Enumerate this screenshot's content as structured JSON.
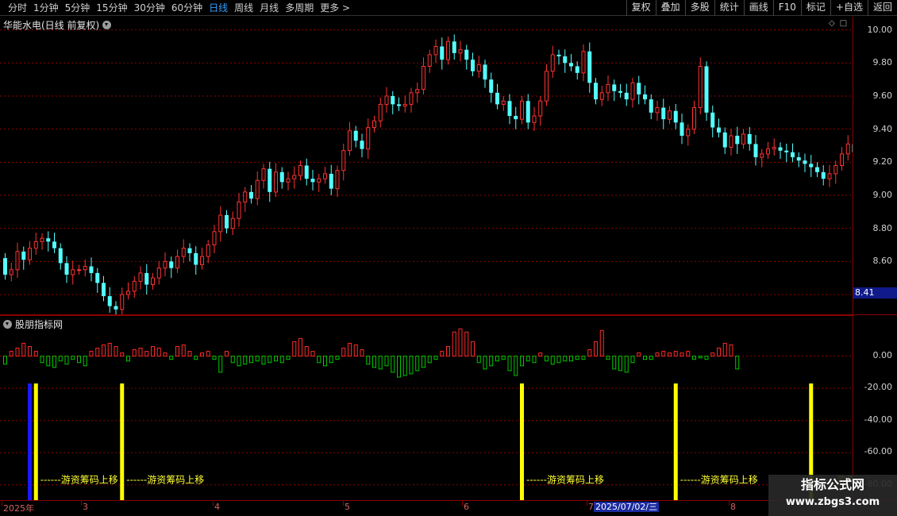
{
  "toolbar": {
    "periods": [
      "分时",
      "1分钟",
      "5分钟",
      "15分钟",
      "30分钟",
      "60分钟",
      "日线",
      "周线",
      "月线",
      "多周期",
      "更多 >"
    ],
    "active_period": "日线",
    "tools": [
      "复权",
      "叠加",
      "多股",
      "统计",
      "画线",
      "F10",
      "标记",
      "+自选",
      "返回"
    ]
  },
  "main_panel": {
    "title": "华能水电(日线 前复权)",
    "current_price_label": "8.41",
    "corner_icons": [
      "diamond-icon",
      "square-icon"
    ]
  },
  "sub_panel": {
    "title": "股朋指标网",
    "signal_label": "游资筹码上移",
    "signal_prefix": "------"
  },
  "x_axis": {
    "labels": [
      "2025年",
      "3",
      "4",
      "5",
      "6",
      "7",
      "8"
    ],
    "cursor_date": "2025/07/02/三"
  },
  "watermark": {
    "title": "指标公式网",
    "url": "www.zbgs3.com"
  },
  "colors": {
    "up": "#ff3232",
    "down": "#54ffff",
    "grid": "#8b0000",
    "osc_up": "#ff2a2a",
    "osc_down": "#00c800",
    "signal_yellow": "#ffff00",
    "signal_blue": "#1a1aff",
    "label_yellow": "#ffff33"
  },
  "chart_data": [
    {
      "type": "candlestick",
      "title": "华能水电(日线 前复权)",
      "y_axis_ticks": [
        "10.00",
        "9.80",
        "9.60",
        "9.40",
        "9.20",
        "9.00",
        "8.80",
        "8.60",
        "8.40"
      ],
      "ylim": [
        8.28,
        10.08
      ],
      "current_price": 8.41,
      "close": [
        8.52,
        8.55,
        8.66,
        8.61,
        8.68,
        8.72,
        8.74,
        8.72,
        8.68,
        8.59,
        8.52,
        8.55,
        8.55,
        8.57,
        8.53,
        8.47,
        8.39,
        8.33,
        8.31,
        8.4,
        8.42,
        8.48,
        8.53,
        8.46,
        8.5,
        8.56,
        8.6,
        8.56,
        8.63,
        8.68,
        8.65,
        8.58,
        8.63,
        8.7,
        8.78,
        8.88,
        8.8,
        8.86,
        8.96,
        9.02,
        8.98,
        9.09,
        9.16,
        9.02,
        9.14,
        9.08,
        9.1,
        9.12,
        9.18,
        9.1,
        9.08,
        9.1,
        9.13,
        9.04,
        9.15,
        9.27,
        9.39,
        9.33,
        9.28,
        9.41,
        9.45,
        9.55,
        9.6,
        9.55,
        9.54,
        9.55,
        9.62,
        9.64,
        9.78,
        9.85,
        9.9,
        9.82,
        9.93,
        9.86,
        9.88,
        9.82,
        9.75,
        9.79,
        9.7,
        9.62,
        9.55,
        9.57,
        9.48,
        9.46,
        9.57,
        9.44,
        9.48,
        9.57,
        9.75,
        9.85,
        9.84,
        9.8,
        9.78,
        9.74,
        9.87,
        9.68,
        9.58,
        9.62,
        9.67,
        9.63,
        9.62,
        9.58,
        9.68,
        9.61,
        9.58,
        9.5,
        9.53,
        9.46,
        9.51,
        9.44,
        9.36,
        9.4,
        9.53,
        9.78,
        9.5,
        9.41,
        9.38,
        9.29,
        9.36,
        9.31,
        9.37,
        9.31,
        9.23,
        9.25,
        9.28,
        9.29,
        9.27,
        9.26,
        9.23,
        9.21,
        9.19,
        9.17,
        9.14,
        9.1,
        9.13,
        9.18,
        9.25,
        9.31,
        9.26
      ],
      "open": [
        8.62,
        8.52,
        8.55,
        8.66,
        8.61,
        8.68,
        8.72,
        8.74,
        8.72,
        8.68,
        8.59,
        8.52,
        8.55,
        8.55,
        8.57,
        8.53,
        8.47,
        8.39,
        8.33,
        8.31,
        8.4,
        8.42,
        8.48,
        8.53,
        8.46,
        8.5,
        8.56,
        8.6,
        8.56,
        8.63,
        8.68,
        8.65,
        8.58,
        8.63,
        8.7,
        8.78,
        8.88,
        8.8,
        8.86,
        8.96,
        9.02,
        8.98,
        9.09,
        9.16,
        9.02,
        9.14,
        9.08,
        9.1,
        9.12,
        9.18,
        9.1,
        9.08,
        9.1,
        9.13,
        9.04,
        9.15,
        9.27,
        9.39,
        9.33,
        9.28,
        9.41,
        9.45,
        9.55,
        9.6,
        9.55,
        9.54,
        9.55,
        9.62,
        9.64,
        9.78,
        9.85,
        9.9,
        9.82,
        9.93,
        9.86,
        9.88,
        9.82,
        9.75,
        9.79,
        9.7,
        9.62,
        9.55,
        9.57,
        9.48,
        9.46,
        9.57,
        9.44,
        9.48,
        9.57,
        9.75,
        9.85,
        9.84,
        9.8,
        9.78,
        9.74,
        9.87,
        9.68,
        9.58,
        9.62,
        9.67,
        9.63,
        9.62,
        9.58,
        9.68,
        9.61,
        9.58,
        9.5,
        9.53,
        9.46,
        9.51,
        9.44,
        9.36,
        9.4,
        9.53,
        9.78,
        9.5,
        9.41,
        9.38,
        9.29,
        9.36,
        9.31,
        9.37,
        9.31,
        9.23,
        9.25,
        9.28,
        9.29,
        9.27,
        9.26,
        9.23,
        9.21,
        9.19,
        9.17,
        9.14,
        9.1,
        9.13,
        9.18,
        9.25,
        9.31
      ]
    },
    {
      "type": "bar",
      "title": "股朋指标网",
      "y_axis_ticks": [
        "0.00",
        "-20.00",
        "-40.00",
        "-60.00",
        "-80.00"
      ],
      "ylim": [
        -90,
        25
      ],
      "oscillator": [
        -5,
        3,
        5,
        8,
        6,
        3,
        -4,
        -6,
        -7,
        -3,
        -5,
        -2,
        -4,
        -6,
        3,
        5,
        7,
        8,
        6,
        2,
        -3,
        4,
        5,
        3,
        6,
        5,
        2,
        -2,
        6,
        7,
        3,
        -2,
        2,
        3,
        -2,
        -10,
        3,
        -4,
        -6,
        -5,
        -4,
        -3,
        -5,
        -4,
        -3,
        -4,
        -2,
        9,
        11,
        6,
        3,
        -4,
        -6,
        -4,
        -2,
        5,
        8,
        7,
        4,
        -5,
        -7,
        -8,
        -6,
        -10,
        -13,
        -12,
        -11,
        -9,
        -7,
        -4,
        -2,
        3,
        6,
        15,
        17,
        15,
        9,
        -4,
        -8,
        -6,
        -3,
        -2,
        -9,
        -12,
        -6,
        -3,
        -4,
        2,
        -3,
        -5,
        -4,
        -3,
        -3,
        -2,
        -2,
        4,
        9,
        16,
        -2,
        -8,
        -9,
        -10,
        -4,
        2,
        -2,
        -2,
        2,
        3,
        2,
        3,
        2,
        3,
        -2,
        -1,
        -2,
        2,
        5,
        8,
        7,
        -8
      ]
    }
  ],
  "signals": [
    {
      "type": "blue",
      "bar_index": 4
    },
    {
      "type": "yellow",
      "bar_index": 5,
      "labeled": true
    },
    {
      "type": "yellow",
      "bar_index": 19,
      "labeled": true
    },
    {
      "type": "yellow",
      "bar_index": 84,
      "labeled": true
    },
    {
      "type": "yellow",
      "bar_index": 109,
      "labeled": true
    },
    {
      "type": "yellow",
      "bar_index": 131,
      "labeled": true
    }
  ]
}
